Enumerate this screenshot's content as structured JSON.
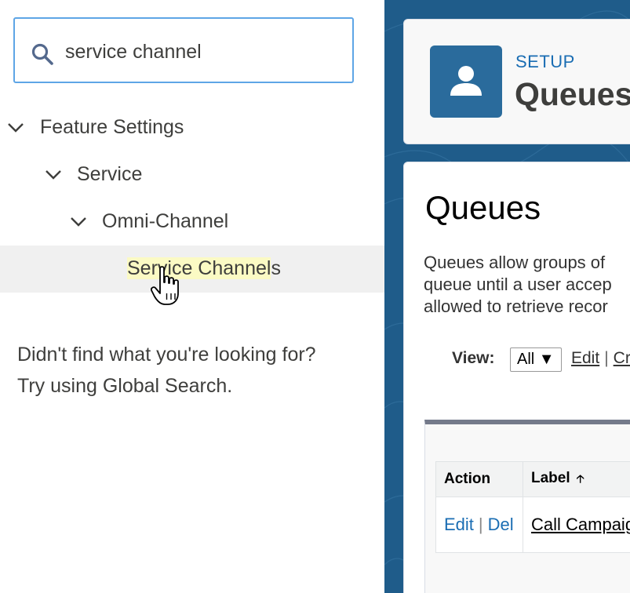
{
  "search": {
    "value": "service channel",
    "icon": "search-icon"
  },
  "tree": {
    "items": [
      {
        "label": "Feature Settings"
      },
      {
        "label": "Service"
      },
      {
        "label": "Omni-Channel"
      },
      {
        "label_highlight": "Service Channel",
        "label_rest": "s"
      }
    ]
  },
  "not_found": {
    "line1": "Didn't find what you're looking for?",
    "line2": "Try using Global Search."
  },
  "header": {
    "setup_label": "SETUP",
    "title": "Queues"
  },
  "main": {
    "title": "Queues",
    "desc_lines": [
      "Queues allow groups of",
      "queue until a user accep",
      "allowed to retrieve recor"
    ],
    "view_label": "View:",
    "view_selected": "All",
    "view_edit": "Edit",
    "view_sep": "|",
    "view_create": "Cr"
  },
  "table": {
    "headers": {
      "action": "Action",
      "label": "Label"
    },
    "rows": [
      {
        "edit": "Edit",
        "sep": "|",
        "del": "Del",
        "label": "Call Campaig"
      }
    ]
  },
  "colors": {
    "accent_blue": "#1a6db3",
    "search_border": "#5ea5e6",
    "highlight": "#fbfac4",
    "right_bg": "#1f5c8a"
  }
}
